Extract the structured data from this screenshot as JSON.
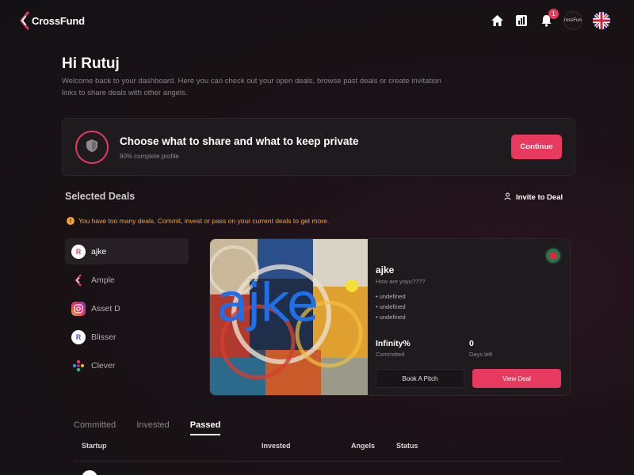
{
  "app": {
    "brand": "CrossFund",
    "notifications_count": "1",
    "avatar_text": "crossFund",
    "language_flag": "uk-flag-icon"
  },
  "header": {
    "greeting": "Hi Rutuj",
    "intro": "Welcome back to your dashboard. Here you can check out your open deals, browse past deals or create invitation links to share deals with other angels."
  },
  "privacy_card": {
    "title": "Choose what to share and what to keep private",
    "subtitle": "90% complete profile",
    "profile_complete_percent": 90,
    "continue_label": "Continue"
  },
  "selected_deals": {
    "title": "Selected Deals",
    "invite_label": "Invite to Deal",
    "warning": "You have too many deals. Commit, invest or pass on your current deals to get more.",
    "items": [
      {
        "label": "ajke",
        "icon": "r-logo-icon"
      },
      {
        "label": "Ample",
        "icon": "crossfund-logo-icon"
      },
      {
        "label": "Asset D",
        "icon": "instagram-icon"
      },
      {
        "label": "Blisser",
        "icon": "r-logo-icon"
      },
      {
        "label": "Clever",
        "icon": "dots-logo-icon"
      }
    ]
  },
  "deal_card": {
    "image_text": "ajke",
    "name": "ajke",
    "tagline": "How are yoyu????",
    "bullets": [
      "• undefined",
      "• undefined",
      "• undefined"
    ],
    "committed_value": "Infinity%",
    "committed_label": "Committed",
    "days_value": "0",
    "days_label": "Days left",
    "pitch_label": "Book A Pitch",
    "view_label": "View Deal",
    "country_flag": "bangladesh-flag-icon"
  },
  "tabs": [
    "Committed",
    "Invested",
    "Passed"
  ],
  "active_tab": "Passed",
  "table": {
    "columns": [
      "Startup",
      "Invested",
      "Angels",
      "Status"
    ]
  },
  "colors": {
    "accent": "#e83a5f",
    "warning": "#f2a33a",
    "background": "#141114"
  }
}
